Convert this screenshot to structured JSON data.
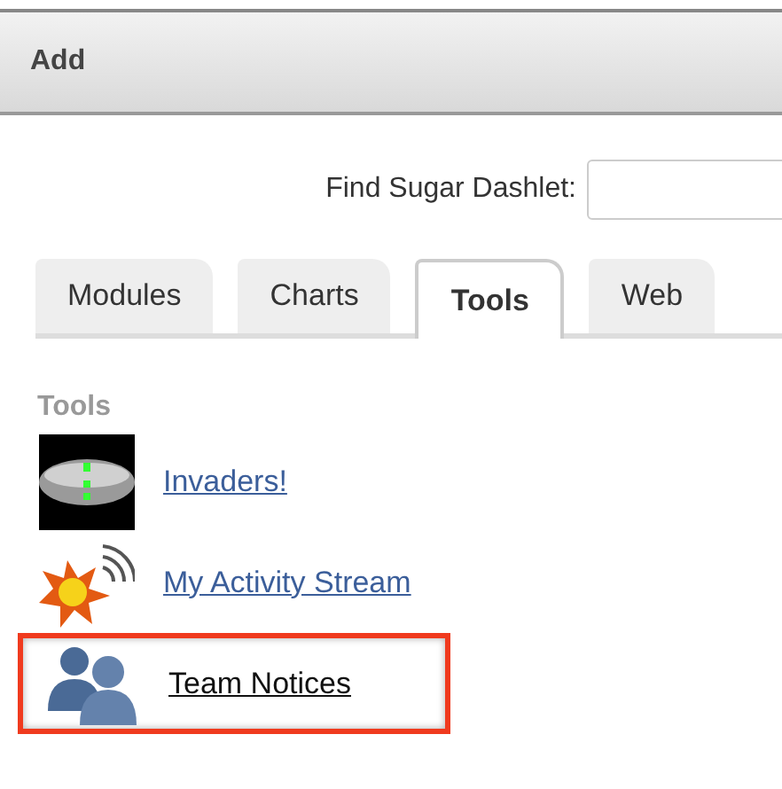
{
  "header": {
    "title": "Add"
  },
  "search": {
    "label": "Find Sugar Dashlet:"
  },
  "tabs": [
    {
      "label": "Modules",
      "selected": false
    },
    {
      "label": "Charts",
      "selected": false
    },
    {
      "label": "Tools",
      "selected": true
    },
    {
      "label": "Web",
      "selected": false
    }
  ],
  "section": {
    "title": "Tools"
  },
  "items": [
    {
      "kind": "invaders",
      "label": "Invaders!",
      "highlighted": false
    },
    {
      "kind": "activity",
      "label": "My Activity Stream",
      "highlighted": false
    },
    {
      "kind": "team",
      "label": "Team Notices",
      "highlighted": true
    }
  ]
}
